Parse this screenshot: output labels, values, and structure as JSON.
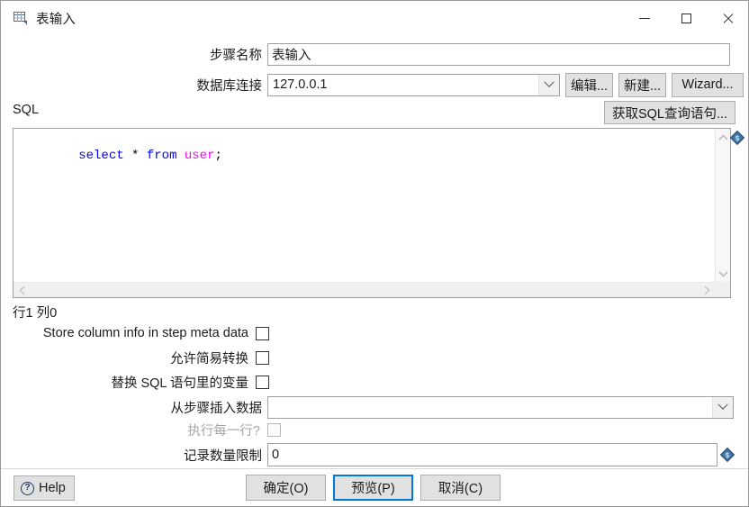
{
  "window": {
    "title": "表输入",
    "icon": "table-input-icon",
    "controls": {
      "minimize": "minimize-icon",
      "maximize": "maximize-icon",
      "close": "close-icon"
    }
  },
  "form": {
    "step_name": {
      "label": "步骤名称",
      "value": "表输入"
    },
    "db_connection": {
      "label": "数据库连接",
      "value": "127.0.0.1",
      "buttons": [
        {
          "label": "编辑...",
          "name": "edit-connection-button"
        },
        {
          "label": "新建...",
          "name": "new-connection-button"
        },
        {
          "label": "Wizard...",
          "name": "wizard-button"
        }
      ]
    },
    "sql": {
      "label": "SQL",
      "get_sql_button": "获取SQL查询语句...",
      "tokens": [
        {
          "text": "select",
          "kind": "keyword"
        },
        {
          "text": " ",
          "kind": "plain"
        },
        {
          "text": "*",
          "kind": "operator"
        },
        {
          "text": " ",
          "kind": "plain"
        },
        {
          "text": "from",
          "kind": "keyword"
        },
        {
          "text": " ",
          "kind": "plain"
        },
        {
          "text": "user",
          "kind": "identifier"
        },
        {
          "text": ";",
          "kind": "operator"
        }
      ],
      "plain_text": "select * from user;",
      "status": "行1 列0"
    },
    "checkboxes": [
      {
        "label": "Store column info in step meta data",
        "checked": false,
        "enabled": true
      },
      {
        "label": "允许简易转换",
        "checked": false,
        "enabled": true
      },
      {
        "label": "替换 SQL 语句里的变量",
        "checked": false,
        "enabled": true
      }
    ],
    "insert_from_step": {
      "label": "从步骤插入数据",
      "value": ""
    },
    "execute_each_row": {
      "label": "执行每一行?",
      "checked": false,
      "enabled": false
    },
    "record_limit": {
      "label": "记录数量限制",
      "value": "0"
    }
  },
  "footer": {
    "help": "Help",
    "ok": "确定(O)",
    "preview": "预览(P)",
    "cancel": "取消(C)"
  },
  "colors": {
    "accent": "#0078d7",
    "keyword": "#0000ff",
    "identifier": "#ff00ff",
    "button_face": "#e1e1e1",
    "border": "#a0a0a0"
  }
}
